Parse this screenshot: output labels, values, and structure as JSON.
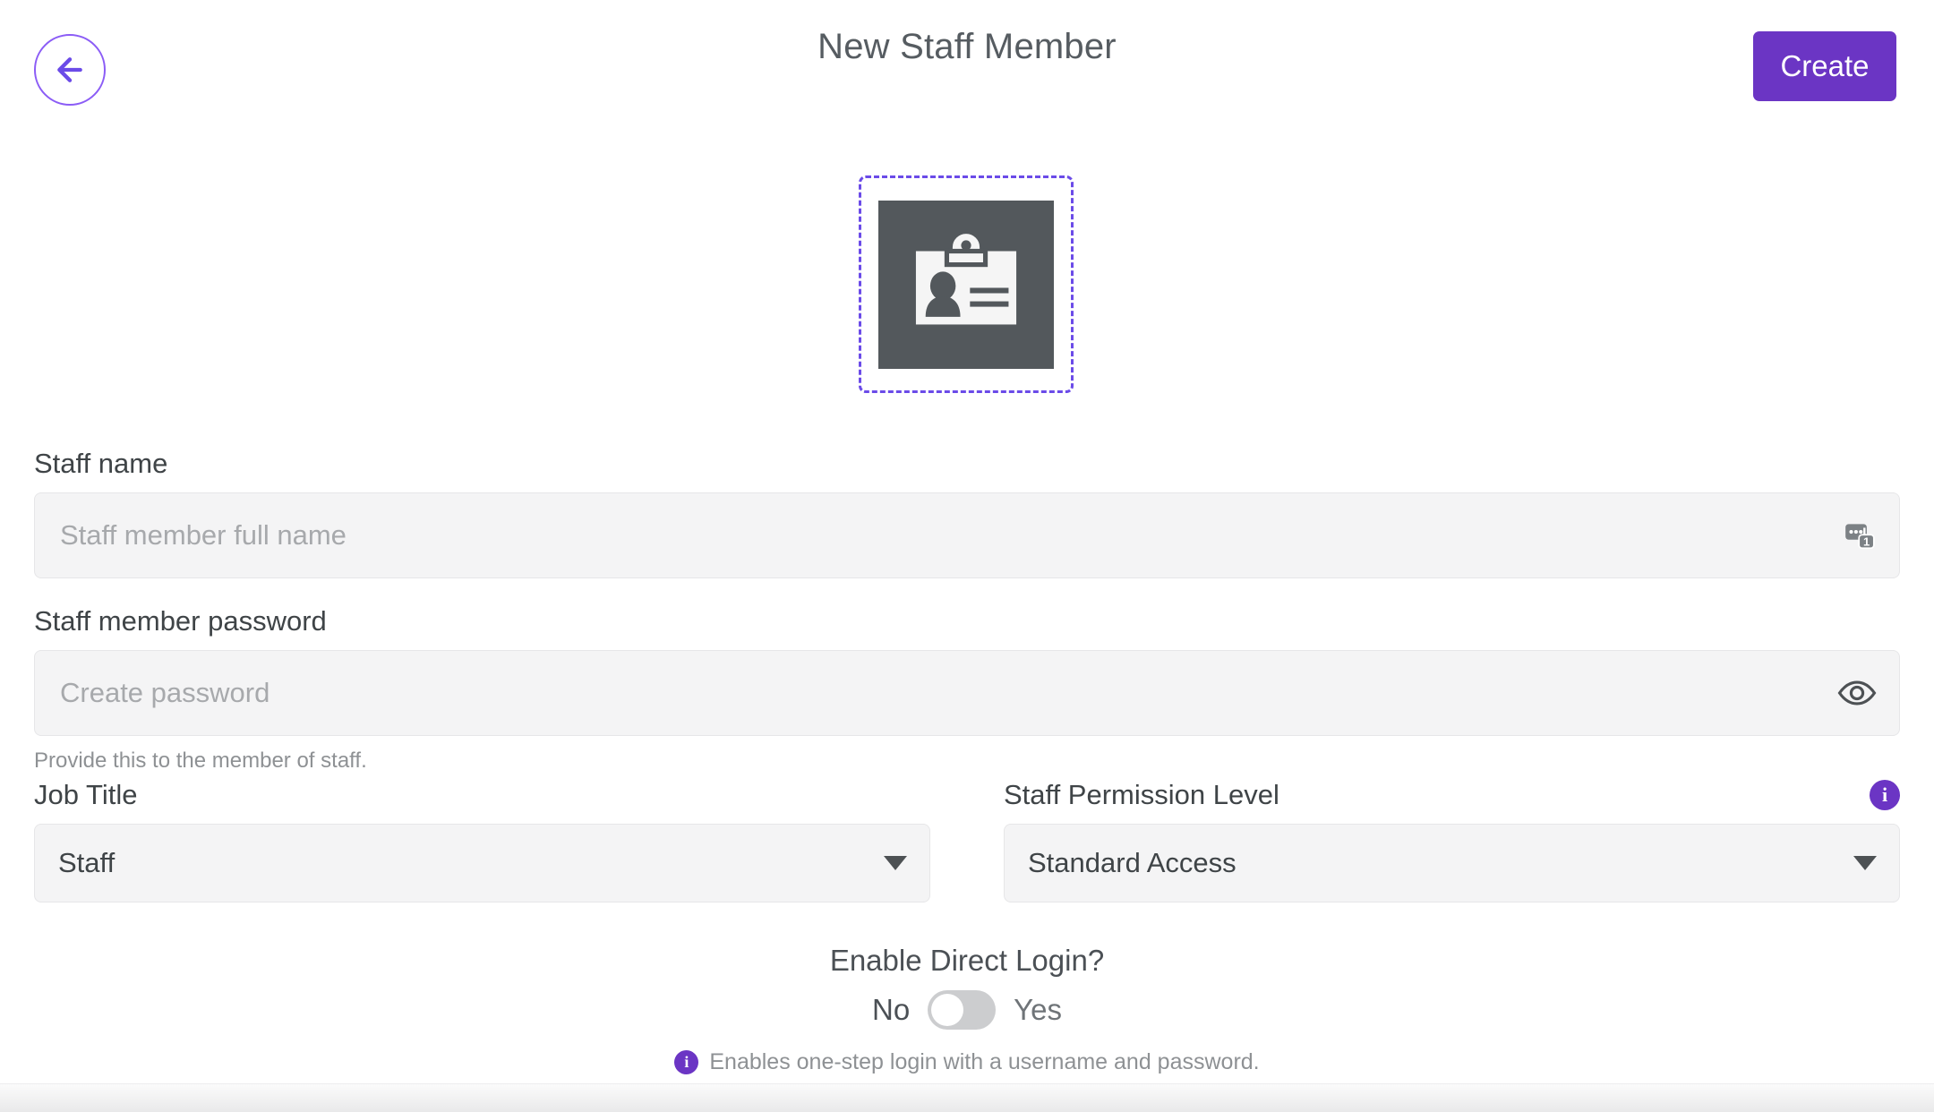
{
  "header": {
    "back_icon": "arrow-left-icon",
    "title": "New Staff Member",
    "create_label": "Create"
  },
  "avatar": {
    "icon": "id-badge-icon",
    "alt": "Staff member photo placeholder"
  },
  "form": {
    "staff_name": {
      "label": "Staff name",
      "placeholder": "Staff member full name",
      "value": "",
      "affix_icon": "text-input-counter-icon"
    },
    "password": {
      "label": "Staff member password",
      "placeholder": "Create password",
      "value": "",
      "affix_icon": "eye-icon",
      "hint": "Provide this to the member of staff."
    },
    "job_title": {
      "label": "Job Title",
      "value": "Staff",
      "caret_icon": "chevron-down-icon"
    },
    "permission_level": {
      "label": "Staff Permission Level",
      "value": "Standard Access",
      "caret_icon": "chevron-down-icon",
      "info_icon": "info-icon",
      "info_glyph": "i"
    },
    "direct_login": {
      "title": "Enable Direct Login?",
      "off_label": "No",
      "on_label": "Yes",
      "state": "off",
      "note": "Enables one-step login with a username and password.",
      "note_info_icon": "info-icon",
      "note_info_glyph": "i"
    }
  },
  "colors": {
    "accent": "#6b35c4",
    "dashed_border": "#6b4be8",
    "field_bg": "#f4f4f5",
    "text": "#3f4447",
    "muted_text": "#8e9194",
    "avatar_bg": "#53585c"
  }
}
